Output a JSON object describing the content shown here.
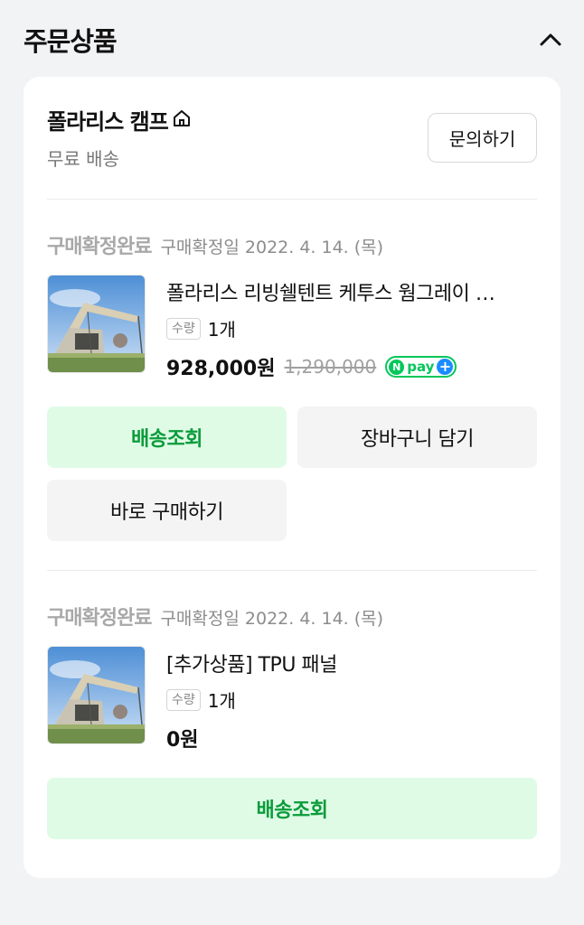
{
  "section": {
    "title": "주문상품",
    "collapse_icon": "chevron-up-icon"
  },
  "store": {
    "name": "폴라리스 캠프",
    "home_icon": "home-icon",
    "shipping": "무료 배송",
    "inquiry_label": "문의하기"
  },
  "orders": [
    {
      "status": "구매확정완료",
      "status_date": "구매확정일 2022. 4. 14. (목)",
      "product_name": "폴라리스 리빙쉘텐트 케투스 웜그레이 …",
      "qty_label": "수량",
      "qty_value": "1개",
      "price": "928,000원",
      "original_price": "1,290,000",
      "badge": {
        "n": "N",
        "text": "pay",
        "plus": "+"
      },
      "buttons": {
        "track": "배송조회",
        "cart": "장바구니 담기",
        "buy_now": "바로 구매하기"
      }
    },
    {
      "status": "구매확정완료",
      "status_date": "구매확정일 2022. 4. 14. (목)",
      "product_name": "[추가상품] TPU 패널",
      "qty_label": "수량",
      "qty_value": "1개",
      "price": "0원",
      "buttons": {
        "track": "배송조회"
      }
    }
  ],
  "colors": {
    "accent_green": "#03c75a",
    "button_green_bg": "#dffbe6",
    "button_green_text": "#0a9c3a"
  }
}
